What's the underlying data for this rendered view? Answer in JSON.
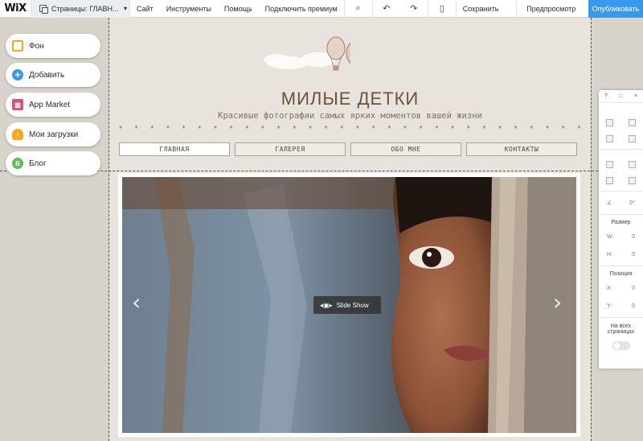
{
  "toolbar": {
    "logo": "WiX",
    "page_select": "Страницы: ГЛАВН...",
    "menu": [
      "Сайт",
      "Инструменты",
      "Помощь",
      "Подключить премиум"
    ],
    "save": "Сохранить",
    "preview": "Предпросмотр",
    "publish": "Опубликовать"
  },
  "left_panel": {
    "items": [
      "Фон",
      "Добавить",
      "App Market",
      "Мои загрузки",
      "Блог"
    ]
  },
  "site": {
    "title": "МИЛЫЕ ДЕТКИ",
    "subtitle": "Красивые фотографии самых ярких моментов вашей жизни",
    "stars": "* * * * * * * * * * * * * * * * * * * * * * * * * * * * * * * * * * * * * * * * * *",
    "nav": [
      "ГЛАВНАЯ",
      "ГАЛЕРЕЯ",
      "ОБО МНЕ",
      "КОНТАКТЫ"
    ],
    "slideshow_label": "Slide Show"
  },
  "inspector": {
    "header": [
      "?",
      ":::",
      "×"
    ],
    "rotation": "0°",
    "size_label": "Размер",
    "w_label": "W:",
    "w_value": "0",
    "h_label": "H:",
    "h_value": "0",
    "position_label": "Позиция",
    "x_label": "X:",
    "x_value": "0",
    "y_label": "Y:",
    "y_value": "0",
    "all_pages_label": "На всех страницах"
  },
  "colors": {
    "accent": "#3899ec",
    "title": "#6e5040"
  }
}
